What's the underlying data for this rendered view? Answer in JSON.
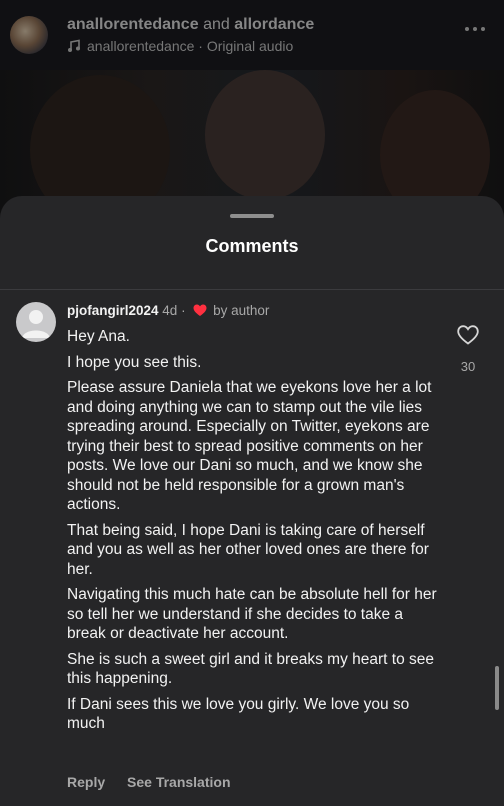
{
  "reel": {
    "author_primary": "anallorentedance",
    "author_joiner": "and",
    "author_secondary": "allordance",
    "audio_text": "anallorentedance · Original audio"
  },
  "sheet": {
    "title": "Comments"
  },
  "comment": {
    "username": "pjofangirl2024",
    "age": "4d",
    "liked_by": "by author",
    "paragraphs": [
      "Hey Ana.",
      "I hope you see this.",
      "Please assure Daniela that we eyekons love her a lot and doing anything we can to stamp out the vile lies spreading around. Especially on Twitter, eyekons are trying their best to spread positive comments on her posts. We love our Dani so much, and we know she should not be held responsible for a grown man's actions.",
      "That being said, I hope Dani is taking care of herself and you as well as her other loved ones are there for her.",
      "Navigating this much hate can be absolute hell for her so tell her we understand if she decides to take a break or deactivate her account.",
      "She is such  a sweet girl and it breaks my heart to see this happening.",
      "If Dani sees this we love you girly. We love you so much"
    ],
    "like_count": "30",
    "reply_label": "Reply",
    "translate_label": "See Translation"
  },
  "colors": {
    "sheet_bg": "#262628",
    "heart_red": "#ff3040",
    "muted_text": "#a8a8a8"
  },
  "icons": [
    "music-icon",
    "more-icon",
    "heart-icon",
    "like-heart-icon",
    "default-avatar-icon"
  ]
}
